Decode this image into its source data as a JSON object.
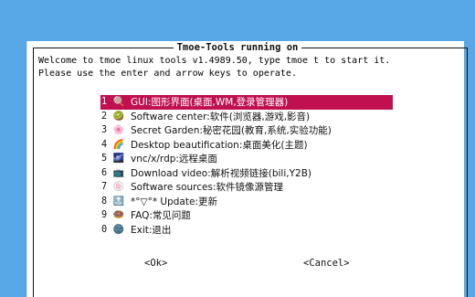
{
  "dialog": {
    "title": "Tmoe-Tools running on",
    "intro_line1": "Welcome to tmoe linux tools v1.4989.50, type tmoe t to start it.",
    "intro_line2": "Please use the enter and arrow keys to operate."
  },
  "menu": {
    "items": [
      {
        "num": "1",
        "icon": "🍭",
        "label": "GUI:图形界面(桌面,WM,登录管理器)",
        "selected": true
      },
      {
        "num": "2",
        "icon": "🥝",
        "label": "Software center:软件(浏览器,游戏,影音)"
      },
      {
        "num": "3",
        "icon": "🌸",
        "label": "Secret Garden:秘密花园(教育,系统,实验功能)"
      },
      {
        "num": "4",
        "icon": "🌈",
        "label": "Desktop beautification:桌面美化(主题)"
      },
      {
        "num": "5",
        "icon": "🌌",
        "label": "vnc/x/rdp:远程桌面"
      },
      {
        "num": "6",
        "icon": "📺",
        "label": "Download video:解析视频链接(bili,Y2B)"
      },
      {
        "num": "7",
        "icon": "🍥",
        "label": "Software sources:软件镜像源管理"
      },
      {
        "num": "8",
        "icon": "🔝",
        "label": "*°▽°* Update:更新"
      },
      {
        "num": "9",
        "icon": "🍩",
        "label": "FAQ:常见问题"
      },
      {
        "num": "0",
        "icon": "🌚",
        "label": "Exit:退出"
      }
    ]
  },
  "buttons": {
    "ok_label": "<Ok>",
    "cancel_label": "<Cancel>"
  },
  "colors": {
    "background": "#58a8e8",
    "dialog": "#ffffff",
    "highlight": "#c01050"
  }
}
